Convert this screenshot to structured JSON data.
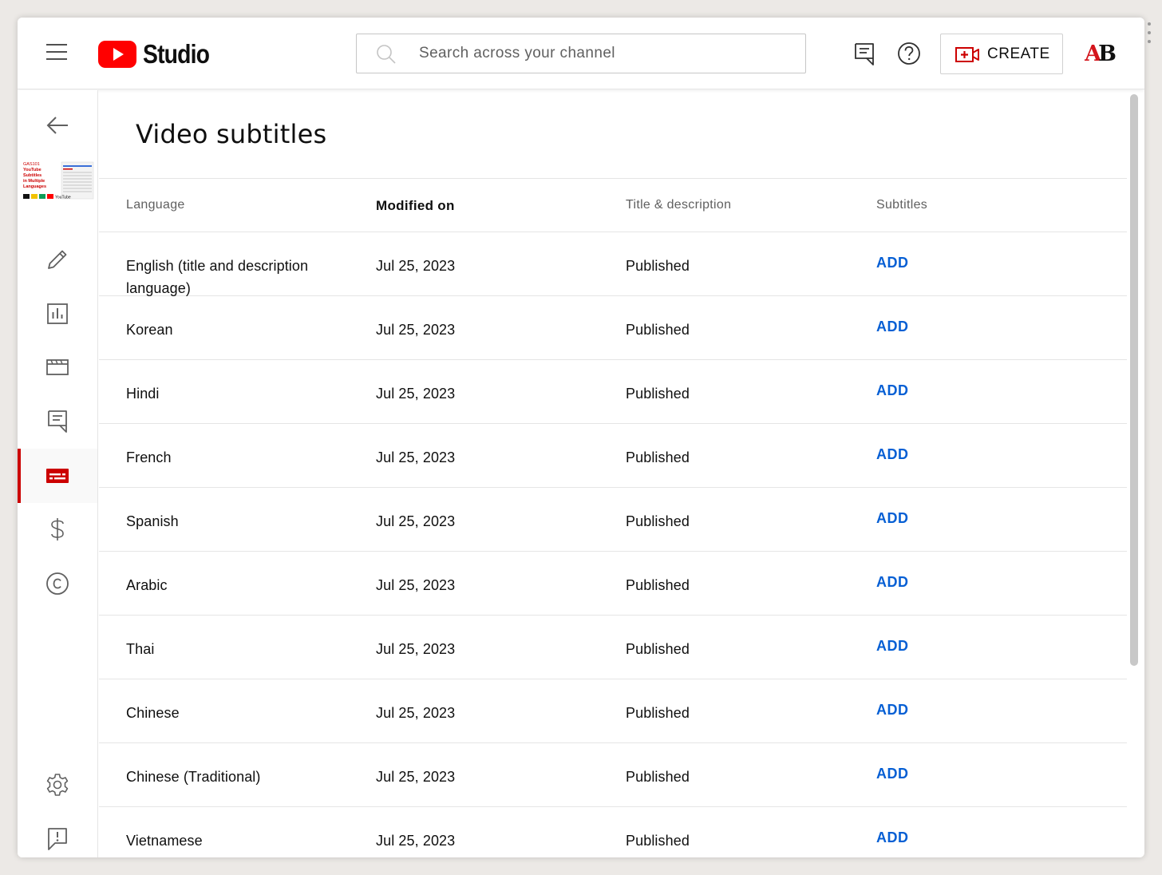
{
  "header": {
    "logo_text": "Studio",
    "search_placeholder": "Search across your channel",
    "create_label": "CREATE",
    "avatar_initials": "AB"
  },
  "sidebar": {
    "thumbnail_lines": [
      "GAS101",
      "YouTube",
      "Subtitles",
      "in Multiple",
      "Languages"
    ],
    "thumbnail_footer": "YouTube",
    "items": [
      {
        "name": "back",
        "icon": "arrow-left-icon"
      },
      {
        "name": "details",
        "icon": "pencil-icon"
      },
      {
        "name": "analytics",
        "icon": "bar-chart-icon"
      },
      {
        "name": "editor",
        "icon": "clapperboard-icon"
      },
      {
        "name": "comments",
        "icon": "comment-icon"
      },
      {
        "name": "subtitles",
        "icon": "subtitles-icon",
        "active": true
      },
      {
        "name": "monetization",
        "icon": "dollar-icon"
      },
      {
        "name": "copyright",
        "icon": "copyright-icon"
      },
      {
        "name": "settings",
        "icon": "gear-icon"
      },
      {
        "name": "feedback",
        "icon": "feedback-icon"
      }
    ]
  },
  "main": {
    "title": "Video subtitles",
    "columns": [
      "Language",
      "Modified on",
      "Title & description",
      "Subtitles"
    ],
    "rows": [
      {
        "language": "English (title and description language)",
        "modified": "Jul 25, 2023",
        "title_desc": "Published",
        "action": "ADD"
      },
      {
        "language": "Korean",
        "modified": "Jul 25, 2023",
        "title_desc": "Published",
        "action": "ADD"
      },
      {
        "language": "Hindi",
        "modified": "Jul 25, 2023",
        "title_desc": "Published",
        "action": "ADD"
      },
      {
        "language": "French",
        "modified": "Jul 25, 2023",
        "title_desc": "Published",
        "action": "ADD"
      },
      {
        "language": "Spanish",
        "modified": "Jul 25, 2023",
        "title_desc": "Published",
        "action": "ADD"
      },
      {
        "language": "Arabic",
        "modified": "Jul 25, 2023",
        "title_desc": "Published",
        "action": "ADD"
      },
      {
        "language": "Thai",
        "modified": "Jul 25, 2023",
        "title_desc": "Published",
        "action": "ADD"
      },
      {
        "language": "Chinese",
        "modified": "Jul 25, 2023",
        "title_desc": "Published",
        "action": "ADD"
      },
      {
        "language": "Chinese (Traditional)",
        "modified": "Jul 25, 2023",
        "title_desc": "Published",
        "action": "ADD"
      },
      {
        "language": "Vietnamese",
        "modified": "Jul 25, 2023",
        "title_desc": "Published",
        "action": "ADD"
      }
    ]
  },
  "colors": {
    "brand_red": "#ff0000",
    "active_red": "#cc0000",
    "link_blue": "#065fd4",
    "text_secondary": "#606060"
  }
}
